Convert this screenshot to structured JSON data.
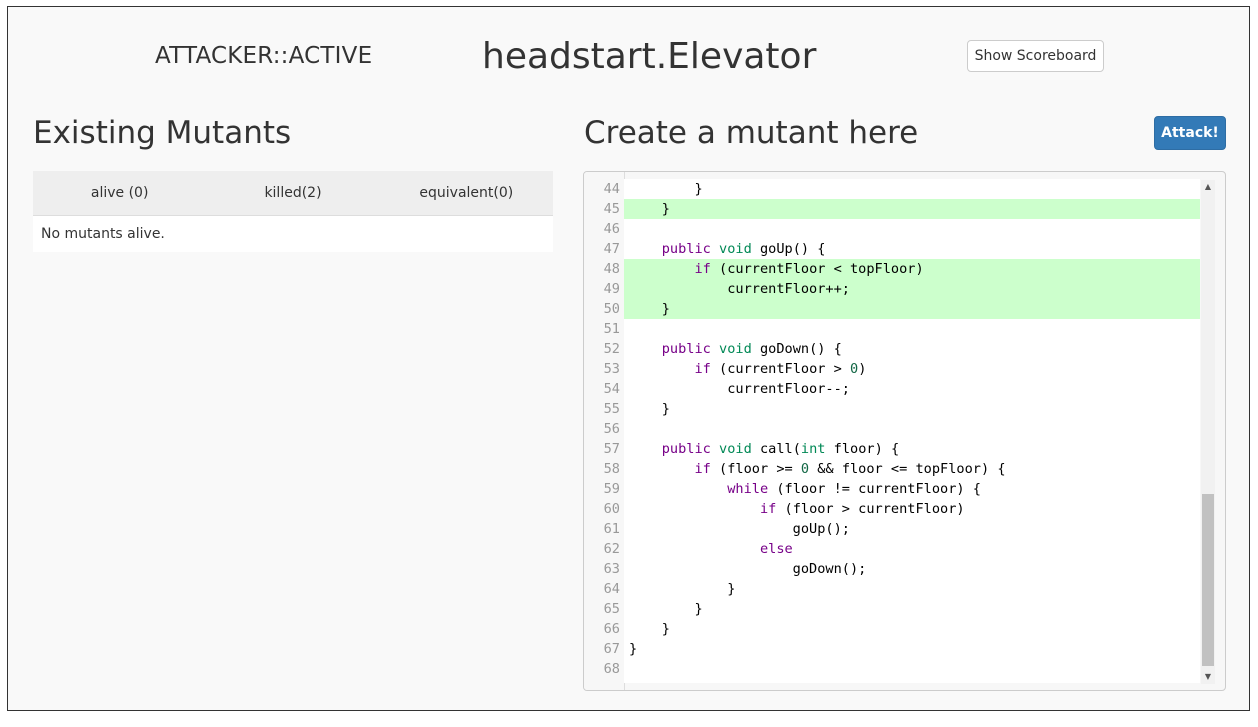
{
  "header": {
    "role": "ATTACKER::ACTIVE",
    "title": "headstart.Elevator",
    "scoreboard_button": "Show Scoreboard"
  },
  "left": {
    "heading": "Existing Mutants",
    "tabs": [
      {
        "label": "alive (0)"
      },
      {
        "label": "killed(2)"
      },
      {
        "label": "equivalent(0)"
      }
    ],
    "empty_message": "No mutants alive."
  },
  "right": {
    "heading": "Create a mutant here",
    "attack_button": "Attack!"
  },
  "colors": {
    "highlight": "#ccffcc",
    "attack_button": "#337ab7",
    "keyword": "#770088",
    "type": "#008855",
    "number": "#116644"
  },
  "editor": {
    "lines": [
      {
        "n": "44",
        "hl": false,
        "html": "        }"
      },
      {
        "n": "45",
        "hl": true,
        "html": "    }"
      },
      {
        "n": "46",
        "hl": false,
        "html": ""
      },
      {
        "n": "47",
        "hl": false,
        "html": "    <span class=\"kw\">public</span> <span class=\"ty\">void</span> goUp() {"
      },
      {
        "n": "48",
        "hl": true,
        "html": "        <span class=\"kw\">if</span> (currentFloor &lt; topFloor)"
      },
      {
        "n": "49",
        "hl": true,
        "html": "            currentFloor++;"
      },
      {
        "n": "50",
        "hl": true,
        "html": "    }"
      },
      {
        "n": "51",
        "hl": false,
        "html": ""
      },
      {
        "n": "52",
        "hl": false,
        "html": "    <span class=\"kw\">public</span> <span class=\"ty\">void</span> goDown() {"
      },
      {
        "n": "53",
        "hl": false,
        "html": "        <span class=\"kw\">if</span> (currentFloor &gt; <span class=\"nm\">0</span>)"
      },
      {
        "n": "54",
        "hl": false,
        "html": "            currentFloor--;"
      },
      {
        "n": "55",
        "hl": false,
        "html": "    }"
      },
      {
        "n": "56",
        "hl": false,
        "html": ""
      },
      {
        "n": "57",
        "hl": false,
        "html": "    <span class=\"kw\">public</span> <span class=\"ty\">void</span> call(<span class=\"ty\">int</span> floor) {"
      },
      {
        "n": "58",
        "hl": false,
        "html": "        <span class=\"kw\">if</span> (floor &gt;= <span class=\"nm\">0</span> &amp;&amp; floor &lt;= topFloor) {"
      },
      {
        "n": "59",
        "hl": false,
        "html": "            <span class=\"kw\">while</span> (floor != currentFloor) {"
      },
      {
        "n": "60",
        "hl": false,
        "html": "                <span class=\"kw\">if</span> (floor &gt; currentFloor)"
      },
      {
        "n": "61",
        "hl": false,
        "html": "                    goUp();"
      },
      {
        "n": "62",
        "hl": false,
        "html": "                <span class=\"kw\">else</span>"
      },
      {
        "n": "63",
        "hl": false,
        "html": "                    goDown();"
      },
      {
        "n": "64",
        "hl": false,
        "html": "            }"
      },
      {
        "n": "65",
        "hl": false,
        "html": "        }"
      },
      {
        "n": "66",
        "hl": false,
        "html": "    }"
      },
      {
        "n": "67",
        "hl": false,
        "html": "}"
      },
      {
        "n": "68",
        "hl": false,
        "html": ""
      }
    ]
  }
}
